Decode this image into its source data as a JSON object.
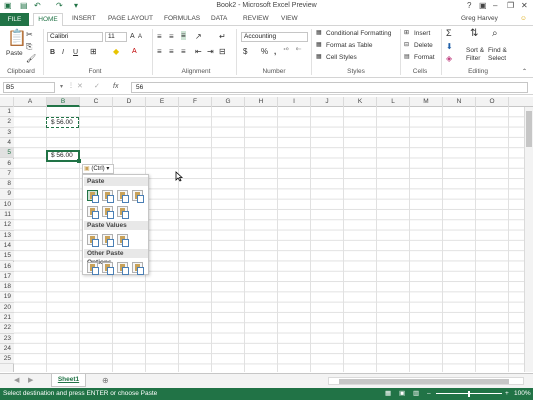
{
  "window": {
    "title": "Book2 - Microsoft Excel Preview",
    "user": "Greg Harvey"
  },
  "tabs": [
    "FILE",
    "HOME",
    "INSERT",
    "PAGE LAYOUT",
    "FORMULAS",
    "DATA",
    "REVIEW",
    "VIEW"
  ],
  "ribbon": {
    "paste_label": "Paste",
    "font_name": "Calibri",
    "font_size": "11",
    "number_format": "Accounting",
    "conditional_formatting": "Conditional Formatting",
    "format_as_table": "Format as Table",
    "cell_styles": "Cell Styles",
    "insert": "Insert",
    "delete": "Delete",
    "format": "Format",
    "sort_filter": "Sort &",
    "sort_filter2": "Filter",
    "find_select": "Find &",
    "find_select2": "Select",
    "groups": {
      "clipboard": "Clipboard",
      "font": "Font",
      "alignment": "Alignment",
      "number": "Number",
      "styles": "Styles",
      "cells": "Cells",
      "editing": "Editing"
    },
    "bold": "B",
    "italic": "I",
    "underline": "U",
    "percent": "%",
    "comma": ","
  },
  "formula_bar": {
    "name_box": "B5",
    "fx": "fx",
    "value": "56"
  },
  "columns": [
    "A",
    "B",
    "C",
    "D",
    "E",
    "F",
    "G",
    "H",
    "I",
    "J",
    "K",
    "L",
    "M",
    "N",
    "O"
  ],
  "rows": [
    "1",
    "2",
    "3",
    "4",
    "5",
    "6",
    "7",
    "8",
    "9",
    "10",
    "11",
    "12",
    "13",
    "14",
    "15",
    "16",
    "17",
    "18",
    "19",
    "20",
    "21",
    "22",
    "23",
    "24",
    "25"
  ],
  "cells": {
    "b2": "$  56.00",
    "b5": "$  56.00"
  },
  "paste_options": {
    "button": "(Ctrl)",
    "sections": [
      "Paste",
      "Paste Values",
      "Other Paste Options"
    ]
  },
  "sheet": {
    "tab": "Sheet1"
  },
  "status": {
    "text": "Select destination and press ENTER or choose Paste",
    "zoom": "100%"
  },
  "colors": {
    "accent": "#217346"
  }
}
